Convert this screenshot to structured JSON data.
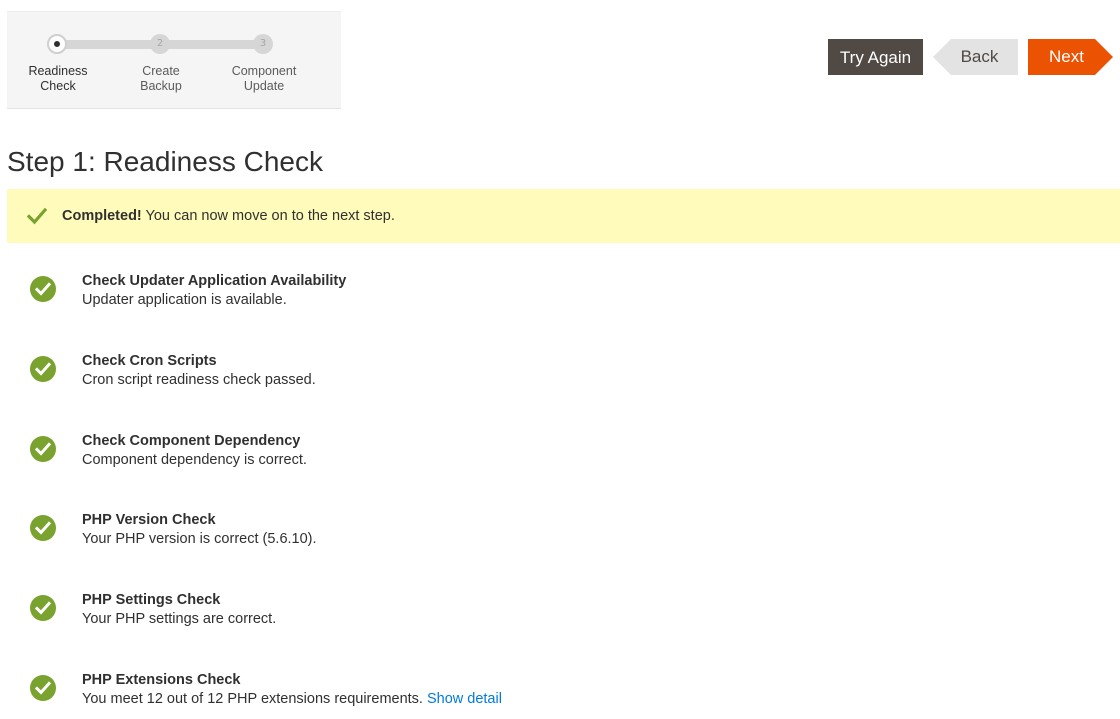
{
  "progress": {
    "steps": [
      {
        "number": "1",
        "label_line1": "Readiness",
        "label_line2": "Check",
        "state": "active"
      },
      {
        "number": "2",
        "label_line1": "Create",
        "label_line2": "Backup",
        "state": "pending"
      },
      {
        "number": "3",
        "label_line1": "Component",
        "label_line2": "Update",
        "state": "pending"
      }
    ]
  },
  "actions": {
    "try_again_label": "Try Again",
    "back_label": "Back",
    "next_label": "Next"
  },
  "page": {
    "title": "Step 1: Readiness Check"
  },
  "banner": {
    "icon": "checkmark-icon",
    "strong": "Completed!",
    "text": " You can now move on to the next step."
  },
  "checks": [
    {
      "title": "Check Updater Application Availability",
      "description": "Updater application is available.",
      "status": "success"
    },
    {
      "title": "Check Cron Scripts",
      "description": "Cron script readiness check passed.",
      "status": "success"
    },
    {
      "title": "Check Component Dependency",
      "description": "Component dependency is correct.",
      "status": "success"
    },
    {
      "title": "PHP Version Check",
      "description": "Your PHP version is correct (5.6.10).",
      "status": "success"
    },
    {
      "title": "PHP Settings Check",
      "description": "Your PHP settings are correct.",
      "status": "success"
    },
    {
      "title": "PHP Extensions Check",
      "description": "You meet 12 out of 12 PHP extensions requirements.",
      "status": "success",
      "link": "Show detail"
    }
  ],
  "colors": {
    "accent_next": "#eb5202",
    "button_dark": "#514943",
    "success": "#79a22e",
    "banner_bg": "#fffbbb",
    "link": "#007bdb"
  }
}
